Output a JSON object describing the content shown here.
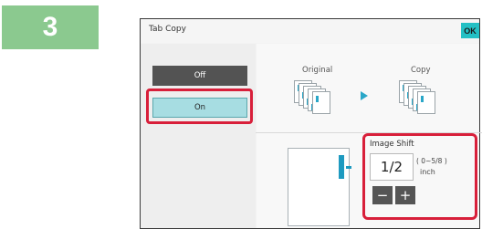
{
  "step": {
    "number": "3"
  },
  "dialog": {
    "title": "Tab Copy",
    "ok_label": "OK"
  },
  "mode": {
    "off_label": "Off",
    "on_label": "On",
    "selected": "On"
  },
  "preview": {
    "original_label": "Original",
    "copy_label": "Copy"
  },
  "image_shift": {
    "label": "Image Shift",
    "value": "1/2",
    "range": "( 0~5/8 )",
    "unit": "inch",
    "minus_label": "−",
    "plus_label": "+"
  },
  "colors": {
    "step_badge": "#8bc98f",
    "ok_button": "#23c0c4",
    "highlight": "#d81f3a",
    "on_button": "#a7dde2",
    "off_button": "#535353",
    "accent_blue": "#2aa7c8"
  }
}
